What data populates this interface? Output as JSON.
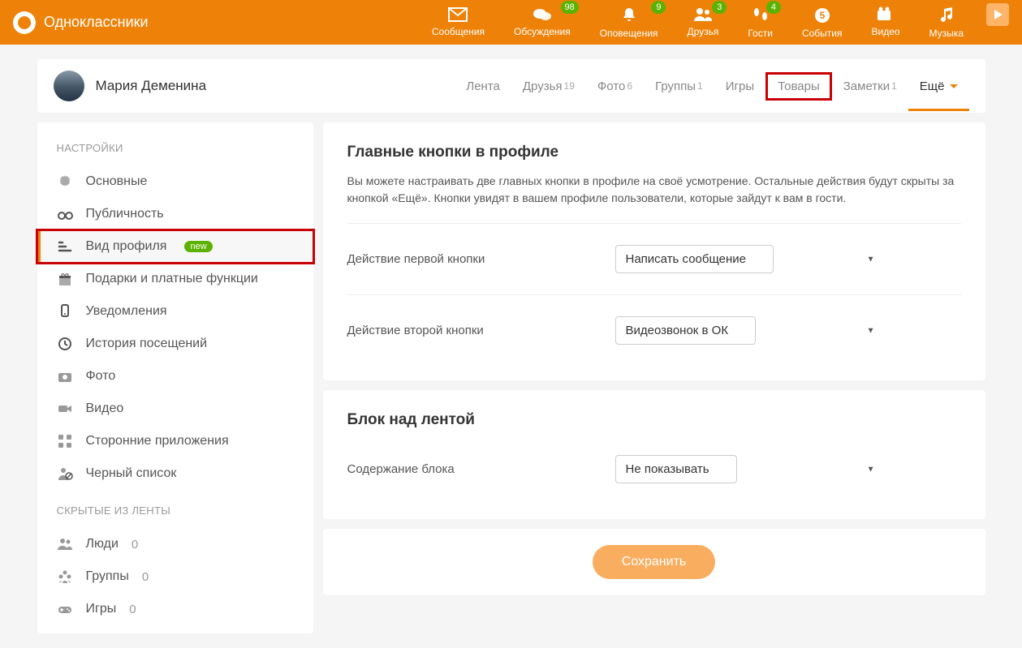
{
  "site_name": "Одноклассники",
  "header_nav": [
    {
      "label": "Сообщения",
      "badge": null
    },
    {
      "label": "Обсуждения",
      "badge": "98"
    },
    {
      "label": "Оповещения",
      "badge": "9"
    },
    {
      "label": "Друзья",
      "badge": "3"
    },
    {
      "label": "Гости",
      "badge": "4"
    },
    {
      "label": "События",
      "badge": null
    },
    {
      "label": "Видео",
      "badge": null
    },
    {
      "label": "Музыка",
      "badge": null
    }
  ],
  "user": {
    "name": "Мария Деменина"
  },
  "profile_tabs": [
    {
      "label": "Лента",
      "count": null,
      "highlight": false
    },
    {
      "label": "Друзья",
      "count": "19",
      "highlight": false
    },
    {
      "label": "Фото",
      "count": "6",
      "highlight": false
    },
    {
      "label": "Группы",
      "count": "1",
      "highlight": false
    },
    {
      "label": "Игры",
      "count": null,
      "highlight": false
    },
    {
      "label": "Товары",
      "count": null,
      "highlight": true
    },
    {
      "label": "Заметки",
      "count": "1",
      "highlight": false
    }
  ],
  "more_label": "Ещё",
  "sidebar": {
    "title": "НАСТРОЙКИ",
    "items": [
      {
        "label": "Основные",
        "active": false,
        "box": false,
        "new": null,
        "count": null
      },
      {
        "label": "Публичность",
        "active": false,
        "box": false,
        "new": null,
        "count": null
      },
      {
        "label": "Вид профиля",
        "active": true,
        "box": true,
        "new": "new",
        "count": null
      },
      {
        "label": "Подарки и платные функции",
        "active": false,
        "box": false,
        "new": null,
        "count": null
      },
      {
        "label": "Уведомления",
        "active": false,
        "box": false,
        "new": null,
        "count": null
      },
      {
        "label": "История посещений",
        "active": false,
        "box": false,
        "new": null,
        "count": null
      },
      {
        "label": "Фото",
        "active": false,
        "box": false,
        "new": null,
        "count": null
      },
      {
        "label": "Видео",
        "active": false,
        "box": false,
        "new": null,
        "count": null
      },
      {
        "label": "Сторонние приложения",
        "active": false,
        "box": false,
        "new": null,
        "count": null
      },
      {
        "label": "Черный список",
        "active": false,
        "box": false,
        "new": null,
        "count": null
      }
    ],
    "title2": "СКРЫТЫЕ ИЗ ЛЕНТЫ",
    "items2": [
      {
        "label": "Люди",
        "count": "0"
      },
      {
        "label": "Группы",
        "count": "0"
      },
      {
        "label": "Игры",
        "count": "0"
      }
    ]
  },
  "section1": {
    "heading": "Главные кнопки в профиле",
    "desc": "Вы можете настраивать две главных кнопки в профиле на своё усмотрение. Остальные действия будут скрыты за кнопкой «Ещё». Кнопки увидят в вашем профиле пользователи, которые зайдут к вам в гости.",
    "row1_label": "Действие первой кнопки",
    "row1_value": "Написать сообщение",
    "row2_label": "Действие второй кнопки",
    "row2_value": "Видеозвонок в ОК"
  },
  "section2": {
    "heading": "Блок над лентой",
    "row_label": "Содержание блока",
    "row_value": "Не показывать"
  },
  "save_label": "Сохранить"
}
